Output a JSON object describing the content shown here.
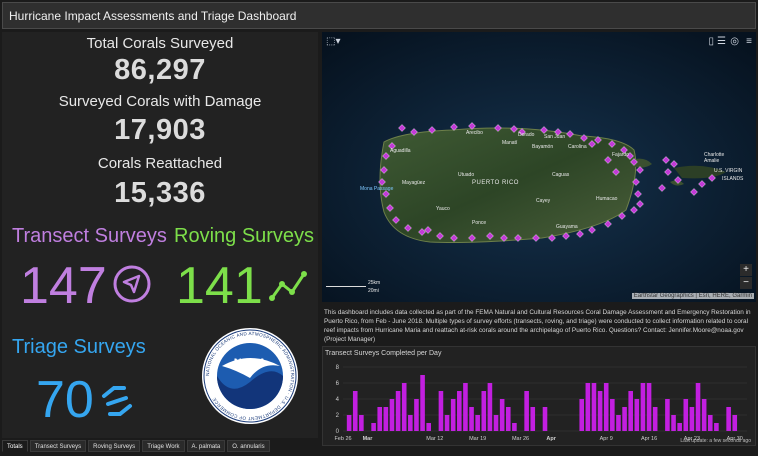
{
  "header": {
    "title": "Hurricane Impact Assessments and Triage Dashboard"
  },
  "stats": [
    {
      "label": "Total Corals Surveyed",
      "value": "86,297"
    },
    {
      "label": "Surveyed Corals with Damage",
      "value": "17,903"
    },
    {
      "label": "Corals Reattached",
      "value": "15,336"
    }
  ],
  "surveys": {
    "transect": {
      "title": "Transect Surveys",
      "value": "147",
      "color": "#c07fe0",
      "icon": "compass-arrow-icon"
    },
    "roving": {
      "title": "Roving Surveys",
      "value": "141",
      "color": "#7ddf4a",
      "icon": "line-trend-icon"
    },
    "triage": {
      "title": "Triage Surveys",
      "value": "70",
      "color": "#35a6f0",
      "icon": "link-icon"
    }
  },
  "logo": {
    "text": "NOAA",
    "ring_text": "NATIONAL OCEANIC AND ATMOSPHERIC ADMINISTRATION · U.S. DEPARTMENT OF COMMERCE"
  },
  "map": {
    "labels": {
      "puerto_rico": "PUERTO RICO",
      "us_virgin": "U.S. VIRGIN",
      "islands": "ISLANDS",
      "charlotte": "Charlotte",
      "amalie": "Amalie",
      "mona": "Mona Passage",
      "san_juan": "San Juan",
      "aguadilla": "Aguadilla",
      "mayaguez": "Mayagüez",
      "ponce": "Ponce",
      "guayama": "Guayama",
      "arecibo": "Arecibo",
      "humacao": "Humacao",
      "caguas": "Caguas",
      "bayamon": "Bayamón",
      "fajardo": "Fajardo",
      "carolina": "Carolina",
      "yauco": "Yauco",
      "utuado": "Utuado",
      "cayey": "Cayey",
      "manati": "Manatí",
      "dorado": "Dorado"
    },
    "scale_km": "25km",
    "scale_mi": "20mi",
    "attribution": "Earthstar Geographics | Esri, HERE, Garmin",
    "zoom_in": "+",
    "zoom_out": "−",
    "marker_color": "#c23bd6",
    "tools": [
      "layers-icon",
      "legend-icon",
      "basemap-icon",
      "menu-icon"
    ]
  },
  "description": "This dashboard includes data collected as part of the FEMA Natural and Cultural Resources Coral Damage Assessment and Emergency Restoration in Puerto Rico, from Feb - June 2018.  Multiple types of survey efforts (transects, roving, and triage) were conducted to collect information related to coral reef impacts from Hurricane Maria and reattach at-risk corals around the archipelago of Puerto Rico.    Questions? Contact: Jennifer.Moore@noaa.gov (Project Manager)",
  "chart_data": {
    "type": "bar",
    "title": "Transect Surveys Completed per Day",
    "ylim": [
      0,
      8
    ],
    "yticks": [
      0,
      2,
      4,
      6,
      8
    ],
    "bar_color": "#c21fe0",
    "xtick_labels": [
      "Feb 26",
      "Mar",
      "Mar 12",
      "Mar 19",
      "Mar 26",
      "Apr",
      "Apr 9",
      "Apr 16",
      "Apr 23",
      "Apr 30"
    ],
    "xtick_days": [
      0,
      4,
      15,
      22,
      29,
      34,
      43,
      50,
      57,
      64
    ],
    "days": [
      1,
      2,
      3,
      5,
      6,
      7,
      8,
      9,
      10,
      11,
      12,
      13,
      14,
      16,
      17,
      18,
      19,
      20,
      21,
      22,
      23,
      24,
      25,
      26,
      27,
      28,
      30,
      31,
      33,
      39,
      40,
      41,
      42,
      43,
      44,
      45,
      46,
      47,
      48,
      49,
      50,
      51,
      53,
      54,
      55,
      56,
      57,
      58,
      59,
      60,
      61,
      63,
      64
    ],
    "values": [
      2,
      5,
      2,
      1,
      3,
      3,
      4,
      5,
      6,
      2,
      4,
      7,
      1,
      5,
      2,
      4,
      5,
      6,
      3,
      2,
      5,
      6,
      2,
      4,
      3,
      1,
      5,
      3,
      3,
      4,
      6,
      6,
      5,
      6,
      4,
      2,
      3,
      5,
      4,
      6,
      6,
      3,
      4,
      2,
      1,
      4,
      3,
      6,
      4,
      2,
      1,
      3,
      2
    ]
  },
  "last_update": "Last update: a few seconds ago",
  "tabs": [
    "Totals",
    "Transect Surveys",
    "Roving Surveys",
    "Triage Work",
    "A. palmata",
    "O. annularis"
  ]
}
